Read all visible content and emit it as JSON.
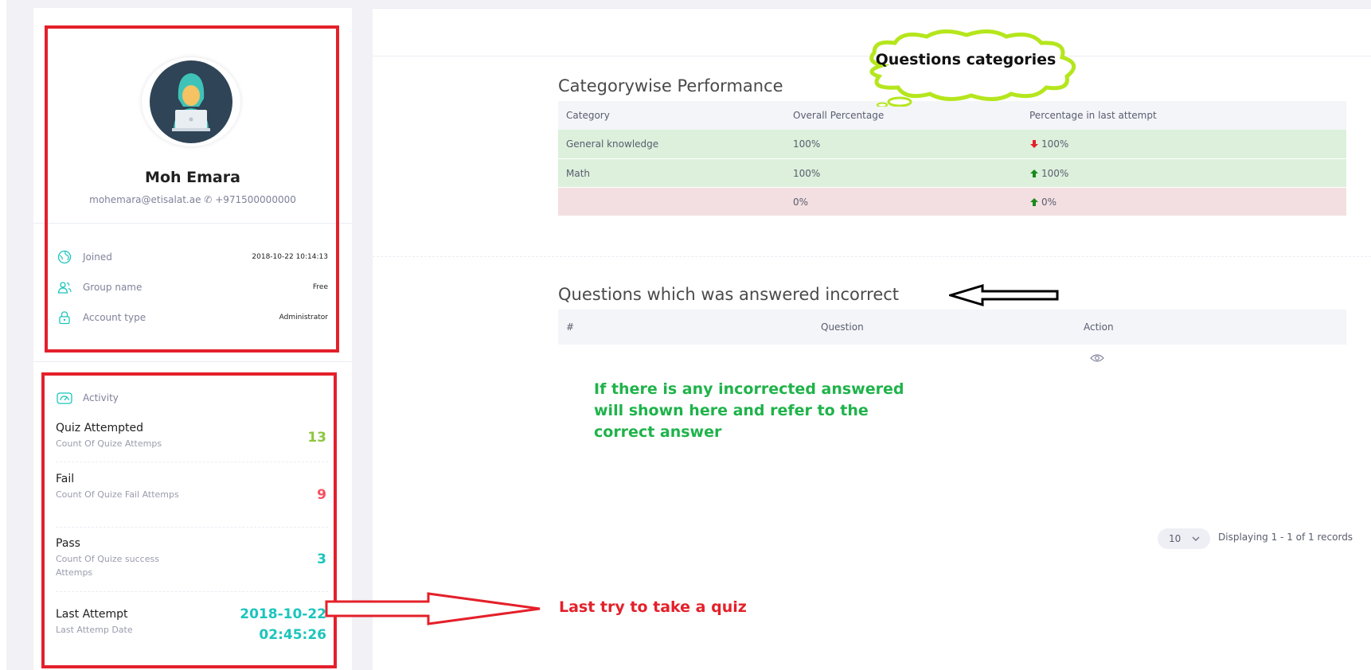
{
  "profile": {
    "name": "Moh Emara",
    "email": "mohemara@etisalat.ae",
    "phone": "+971500000000",
    "avatar_icon": "hacker-avatar-icon",
    "info": [
      {
        "label": "Joined",
        "value": "2018-10-22 10:14:13",
        "icon": "globe-icon"
      },
      {
        "label": "Group name",
        "value": "Free",
        "icon": "users-icon"
      },
      {
        "label": "Account type",
        "value": "Administrator",
        "icon": "lock-icon"
      }
    ]
  },
  "activity": {
    "title": "Activity",
    "icon": "speedometer-icon",
    "stats": [
      {
        "title": "Quiz Attempted",
        "desc": "Count Of Quize Attemps",
        "value": "13",
        "color": "#8dc63f"
      },
      {
        "title": "Fail",
        "desc": "Count Of Quize Fail Attemps",
        "value": "9",
        "color": "#f64e60"
      },
      {
        "title": "Pass",
        "desc": "Count Of Quize success Attemps",
        "value": "3",
        "color": "#1bc5bd"
      },
      {
        "title": "Last Attempt",
        "desc": "Last Attemp Date",
        "value_date": "2018-10-22",
        "value_time": "02:45:26",
        "color": "#1bc5bd"
      }
    ]
  },
  "categorywise": {
    "title": "Categorywise Performance",
    "headers": [
      "Category",
      "Overall Percentage",
      "Percentage in last attempt"
    ],
    "rows": [
      {
        "category": "General knowledge",
        "overall": "100%",
        "last": "100%",
        "trend": "down"
      },
      {
        "category": "Math",
        "overall": "100%",
        "last": "100%",
        "trend": "up"
      },
      {
        "category": "",
        "overall": "0%",
        "last": "0%",
        "trend": "up"
      }
    ]
  },
  "incorrect": {
    "title": "Questions which was answered incorrect",
    "headers": [
      "#",
      "Question",
      "Action"
    ],
    "action_icon": "eye-icon"
  },
  "pagination": {
    "page_size": "10",
    "info": "Displaying 1 - 1 of 1 records"
  },
  "annotations": {
    "cloud": "Questions categories",
    "green_note": "If there is any incorrected answered will shown here and refer to the correct answer",
    "red_note": "Last try to take a quiz"
  },
  "colors": {
    "annotation_red": "#e4202a",
    "annotation_green": "#1fb34a",
    "cloud_border": "#b5e61d",
    "row_green": "#dcf0dc",
    "row_red": "#f3dfe1"
  }
}
